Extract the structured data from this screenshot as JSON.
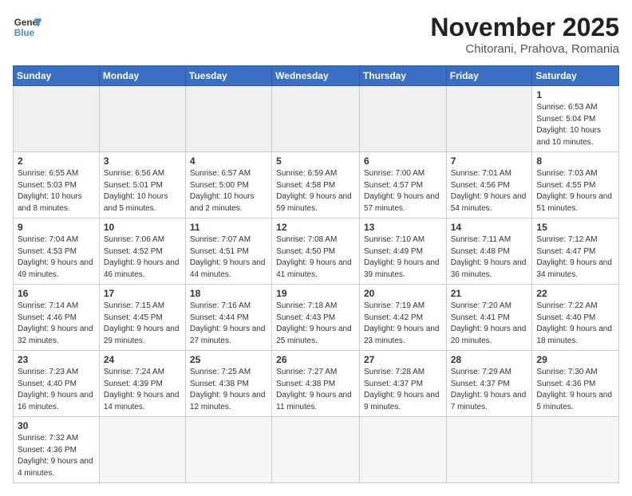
{
  "logo": {
    "text_general": "General",
    "text_blue": "Blue"
  },
  "header": {
    "month": "November 2025",
    "location": "Chitorani, Prahova, Romania"
  },
  "weekdays": [
    "Sunday",
    "Monday",
    "Tuesday",
    "Wednesday",
    "Thursday",
    "Friday",
    "Saturday"
  ],
  "weeks": [
    [
      {
        "day": "",
        "info": ""
      },
      {
        "day": "",
        "info": ""
      },
      {
        "day": "",
        "info": ""
      },
      {
        "day": "",
        "info": ""
      },
      {
        "day": "",
        "info": ""
      },
      {
        "day": "",
        "info": ""
      },
      {
        "day": "1",
        "info": "Sunrise: 6:53 AM\nSunset: 5:04 PM\nDaylight: 10 hours and 10 minutes."
      }
    ],
    [
      {
        "day": "2",
        "info": "Sunrise: 6:55 AM\nSunset: 5:03 PM\nDaylight: 10 hours and 8 minutes."
      },
      {
        "day": "3",
        "info": "Sunrise: 6:56 AM\nSunset: 5:01 PM\nDaylight: 10 hours and 5 minutes."
      },
      {
        "day": "4",
        "info": "Sunrise: 6:57 AM\nSunset: 5:00 PM\nDaylight: 10 hours and 2 minutes."
      },
      {
        "day": "5",
        "info": "Sunrise: 6:59 AM\nSunset: 4:58 PM\nDaylight: 9 hours and 59 minutes."
      },
      {
        "day": "6",
        "info": "Sunrise: 7:00 AM\nSunset: 4:57 PM\nDaylight: 9 hours and 57 minutes."
      },
      {
        "day": "7",
        "info": "Sunrise: 7:01 AM\nSunset: 4:56 PM\nDaylight: 9 hours and 54 minutes."
      },
      {
        "day": "8",
        "info": "Sunrise: 7:03 AM\nSunset: 4:55 PM\nDaylight: 9 hours and 51 minutes."
      }
    ],
    [
      {
        "day": "9",
        "info": "Sunrise: 7:04 AM\nSunset: 4:53 PM\nDaylight: 9 hours and 49 minutes."
      },
      {
        "day": "10",
        "info": "Sunrise: 7:06 AM\nSunset: 4:52 PM\nDaylight: 9 hours and 46 minutes."
      },
      {
        "day": "11",
        "info": "Sunrise: 7:07 AM\nSunset: 4:51 PM\nDaylight: 9 hours and 44 minutes."
      },
      {
        "day": "12",
        "info": "Sunrise: 7:08 AM\nSunset: 4:50 PM\nDaylight: 9 hours and 41 minutes."
      },
      {
        "day": "13",
        "info": "Sunrise: 7:10 AM\nSunset: 4:49 PM\nDaylight: 9 hours and 39 minutes."
      },
      {
        "day": "14",
        "info": "Sunrise: 7:11 AM\nSunset: 4:48 PM\nDaylight: 9 hours and 36 minutes."
      },
      {
        "day": "15",
        "info": "Sunrise: 7:12 AM\nSunset: 4:47 PM\nDaylight: 9 hours and 34 minutes."
      }
    ],
    [
      {
        "day": "16",
        "info": "Sunrise: 7:14 AM\nSunset: 4:46 PM\nDaylight: 9 hours and 32 minutes."
      },
      {
        "day": "17",
        "info": "Sunrise: 7:15 AM\nSunset: 4:45 PM\nDaylight: 9 hours and 29 minutes."
      },
      {
        "day": "18",
        "info": "Sunrise: 7:16 AM\nSunset: 4:44 PM\nDaylight: 9 hours and 27 minutes."
      },
      {
        "day": "19",
        "info": "Sunrise: 7:18 AM\nSunset: 4:43 PM\nDaylight: 9 hours and 25 minutes."
      },
      {
        "day": "20",
        "info": "Sunrise: 7:19 AM\nSunset: 4:42 PM\nDaylight: 9 hours and 23 minutes."
      },
      {
        "day": "21",
        "info": "Sunrise: 7:20 AM\nSunset: 4:41 PM\nDaylight: 9 hours and 20 minutes."
      },
      {
        "day": "22",
        "info": "Sunrise: 7:22 AM\nSunset: 4:40 PM\nDaylight: 9 hours and 18 minutes."
      }
    ],
    [
      {
        "day": "23",
        "info": "Sunrise: 7:23 AM\nSunset: 4:40 PM\nDaylight: 9 hours and 16 minutes."
      },
      {
        "day": "24",
        "info": "Sunrise: 7:24 AM\nSunset: 4:39 PM\nDaylight: 9 hours and 14 minutes."
      },
      {
        "day": "25",
        "info": "Sunrise: 7:25 AM\nSunset: 4:38 PM\nDaylight: 9 hours and 12 minutes."
      },
      {
        "day": "26",
        "info": "Sunrise: 7:27 AM\nSunset: 4:38 PM\nDaylight: 9 hours and 11 minutes."
      },
      {
        "day": "27",
        "info": "Sunrise: 7:28 AM\nSunset: 4:37 PM\nDaylight: 9 hours and 9 minutes."
      },
      {
        "day": "28",
        "info": "Sunrise: 7:29 AM\nSunset: 4:37 PM\nDaylight: 9 hours and 7 minutes."
      },
      {
        "day": "29",
        "info": "Sunrise: 7:30 AM\nSunset: 4:36 PM\nDaylight: 9 hours and 5 minutes."
      }
    ],
    [
      {
        "day": "30",
        "info": "Sunrise: 7:32 AM\nSunset: 4:36 PM\nDaylight: 9 hours and 4 minutes."
      },
      {
        "day": "",
        "info": ""
      },
      {
        "day": "",
        "info": ""
      },
      {
        "day": "",
        "info": ""
      },
      {
        "day": "",
        "info": ""
      },
      {
        "day": "",
        "info": ""
      },
      {
        "day": "",
        "info": ""
      }
    ]
  ]
}
